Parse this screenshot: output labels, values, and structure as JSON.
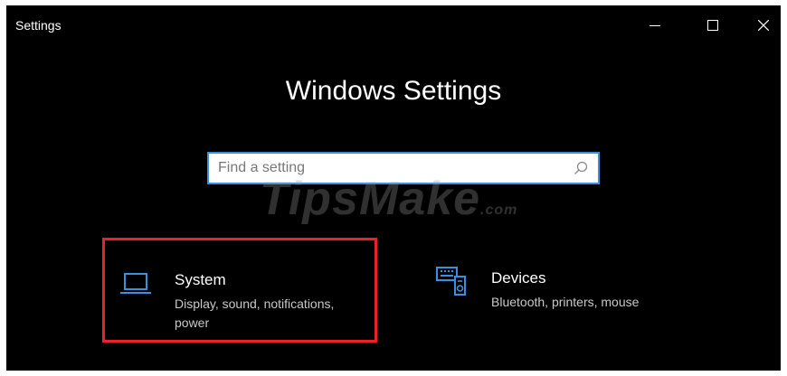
{
  "window": {
    "title": "Settings",
    "controls": {
      "minimize": "minimize",
      "maximize": "maximize",
      "close": "close"
    }
  },
  "main": {
    "heading": "Windows Settings",
    "search": {
      "placeholder": "Find a setting",
      "value": ""
    },
    "watermark": {
      "brand": "TipsMake",
      "suffix": ".com"
    }
  },
  "categories": [
    {
      "name": "System",
      "description": "Display, sound, notifications, power",
      "icon": "laptop-icon",
      "highlighted": true
    },
    {
      "name": "Devices",
      "description": "Bluetooth, printers, mouse",
      "icon": "devices-icon",
      "highlighted": false
    }
  ],
  "colors": {
    "background": "#000000",
    "accent": "#3a8fe0",
    "highlight": "#e8212b",
    "text": "#ffffff",
    "subtext": "#c8c8c8"
  }
}
